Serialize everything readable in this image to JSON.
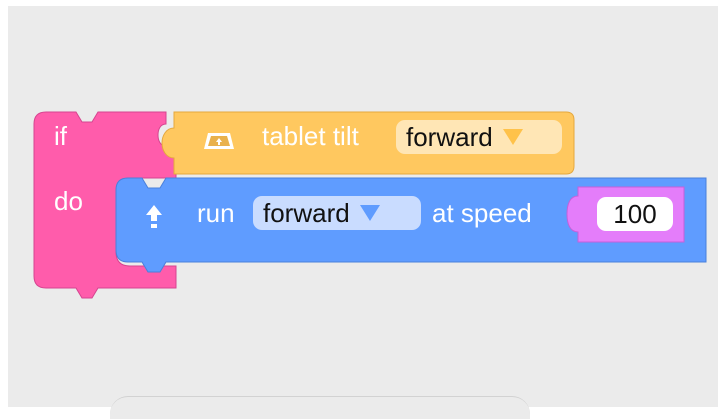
{
  "colors": {
    "workspace_bg": "#ebebeb",
    "control_block": "#ff5cab",
    "sensor_block": "#ffc85f",
    "motion_block": "#5f9cff",
    "value_block": "#e47dfa"
  },
  "if_block": {
    "if_label": "if",
    "do_label": "do"
  },
  "tilt_block": {
    "icon": "tablet-tilt-icon",
    "label": "tablet tilt",
    "direction": "forward"
  },
  "run_block": {
    "icon": "arrow-up-icon",
    "run_label": "run",
    "direction": "forward",
    "speed_label": "at speed",
    "speed_value": "100"
  }
}
